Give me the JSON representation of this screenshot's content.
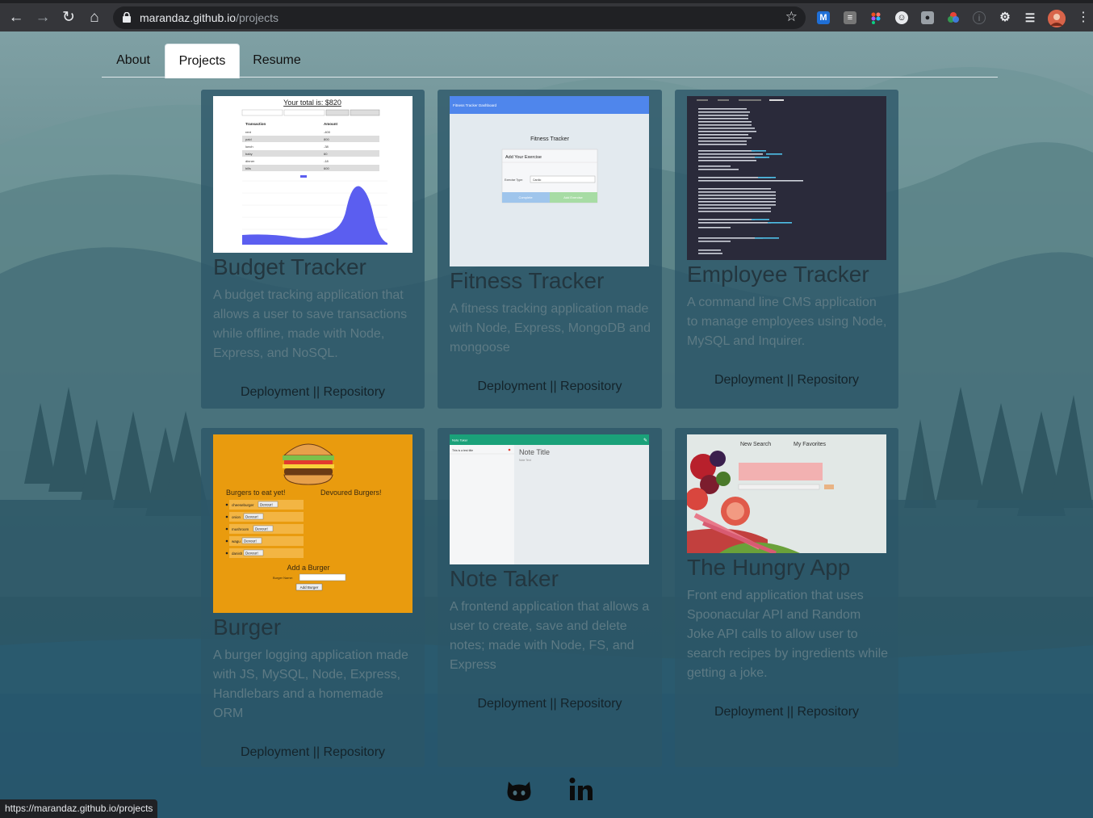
{
  "browser": {
    "url_host": "marandaz.github.io",
    "url_path": "/projects",
    "status_url": "https://marandaz.github.io/projects"
  },
  "tabs": [
    {
      "label": "About"
    },
    {
      "label": "Projects"
    },
    {
      "label": "Resume"
    }
  ],
  "projects": [
    {
      "title": "Budget Tracker",
      "description": "A budget tracking application that allows a user to save transactions while offline, made with Node, Express, and NoSQL.",
      "links": "Deployment || Repository"
    },
    {
      "title": "Fitness Tracker",
      "description": "A fitness tracking application made with Node, Express, MongoDB and mongoose",
      "links": "Deployment || Repository"
    },
    {
      "title": "Employee Tracker",
      "description": "A command line CMS application to manage employees using Node, MySQL and Inquirer.",
      "links": "Deployment || Repository"
    },
    {
      "title": "Burger",
      "description": "A burger logging application made with JS, MySQL, Node, Express, Handlebars and a homemade ORM",
      "links": "Deployment || Repository"
    },
    {
      "title": "Note Taker",
      "description": "A frontend application that allows a user to create, save and delete notes; made with Node, FS, and Express",
      "links": "Deployment || Repository"
    },
    {
      "title": "The Hungry App",
      "description": "Front end application that uses Spoonacular API and Random Joke API calls to allow user to search recipes by ingredients while getting a joke.",
      "links": "Deployment || Repository"
    }
  ],
  "screenshots": {
    "budget": {
      "total": "Your total is: $820",
      "col1": "Transaction",
      "col2": "Amount",
      "rows": [
        [
          "rent",
          "-400"
        ],
        [
          "paid",
          "800"
        ],
        [
          "lunch",
          "-38"
        ],
        [
          "baby",
          "60"
        ],
        [
          "dinner",
          "-18"
        ],
        [
          "bills",
          "600"
        ]
      ]
    },
    "fitness": {
      "header": "Fitness Tracker Dashboard",
      "heading": "Fitness Tracker",
      "box_title": "Add Your Exercise",
      "field_label": "Exercise Type:",
      "field_value": "Cardio",
      "btn1": "Complete",
      "btn2": "Add Exercise"
    },
    "burger": {
      "left": "Burgers to eat yet!",
      "right": "Devoured Burgers!",
      "items": [
        "cheeseburger",
        "onion",
        "mushroom",
        "wagu",
        "danish"
      ],
      "devour": "Devour!",
      "add": "Add a Burger",
      "name_label": "Burger Name:",
      "add_btn": "Add Burger"
    },
    "note": {
      "header": "Note Taker",
      "item": "This is a test title",
      "title": "Note Title",
      "text": "Note Text"
    },
    "hungry": {
      "nav1": "New Search",
      "nav2": "My Favorites"
    }
  },
  "colors": {
    "card_bg": "#2c5668",
    "title": "#23363f",
    "desc": "#5d7a84",
    "budget_area": "#5b5ef0",
    "fitness_header": "#4f86ec",
    "burger_bg": "#e99b0e",
    "note_header": "#1aa179"
  },
  "icons": [
    "github-icon",
    "linkedin-icon"
  ]
}
